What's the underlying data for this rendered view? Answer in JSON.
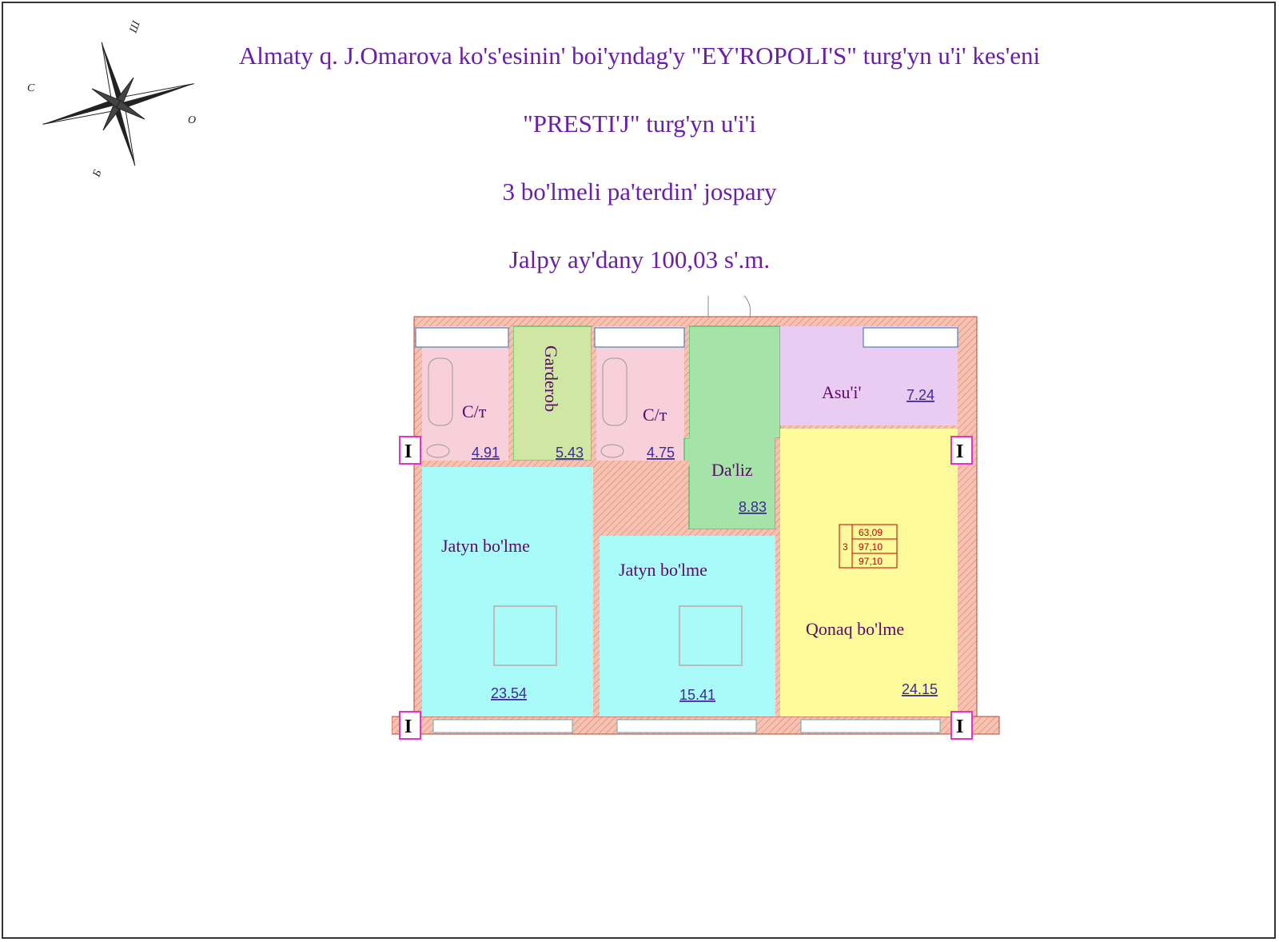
{
  "title_lines": [
    "Almaty q. J.Omarova ko's'esinin' boi'yndag'y \"EY'ROPOLI'S\" turg'yn u'i' kes'eni",
    "\"PRESTI'J\" turg'yn u'i'i",
    "3 bo'lmeli pa'terdin' jospary",
    "Jalpy ay'dany 100,03 s'.m."
  ],
  "compass": {
    "letters": [
      "С",
      "Ш",
      "О",
      "Б"
    ]
  },
  "colors": {
    "title": "#6a1fa8",
    "wall": "#f6c3b3",
    "wall_hatch": "#e07a6a",
    "bath": "#f7d0dc",
    "wardrobe": "#cfe7a3",
    "hall": "#a6e3a9",
    "kitchen": "#eacbf2",
    "bedroom": "#a8fbf9",
    "living": "#fdfa9b",
    "marker": "#e632c5",
    "table": "#c00000"
  },
  "rooms": [
    {
      "id": "bath1",
      "name": "С/т",
      "area": "4.91"
    },
    {
      "id": "wardrobe",
      "name": "Garderob",
      "area": "5.43"
    },
    {
      "id": "bath2",
      "name": "С/т",
      "area": "4.75"
    },
    {
      "id": "hall",
      "name": "Da'liz",
      "area": "8.83"
    },
    {
      "id": "kitchen",
      "name": "Asu'i'",
      "area": "7.24"
    },
    {
      "id": "bedroom1",
      "name": "Jatyn bo'lme",
      "area": "23.54"
    },
    {
      "id": "bedroom2",
      "name": "Jatyn bo'lme",
      "area": "15.41"
    },
    {
      "id": "living",
      "name": "Qonaq bo'lme",
      "area": "24.15"
    }
  ],
  "section_marker": "I",
  "summary_table": {
    "rooms_count": "3",
    "values": [
      "63,09",
      "97,10",
      "97,10"
    ]
  }
}
